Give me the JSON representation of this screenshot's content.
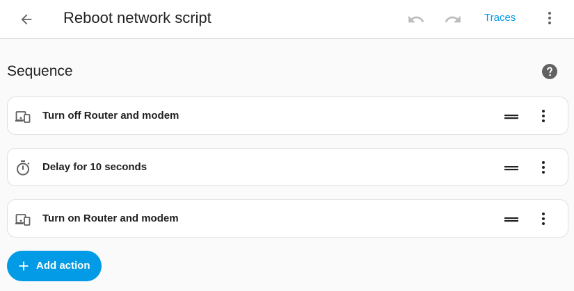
{
  "header": {
    "title": "Reboot network script",
    "traces_label": "Traces",
    "icons": [
      "back-arrow-icon",
      "undo-icon",
      "redo-icon",
      "more-vert-icon"
    ]
  },
  "sequence": {
    "title": "Sequence",
    "help_icon": "help-circle-icon",
    "actions": [
      {
        "label": "Turn off Router and modem",
        "icon": "devices-icon"
      },
      {
        "label": "Delay for 10 seconds",
        "icon": "timer-icon"
      },
      {
        "label": "Turn on Router and modem",
        "icon": "devices-icon"
      }
    ],
    "add_label": "Add action"
  },
  "colors": {
    "accent": "#039be5",
    "text": "#212121",
    "icon": "#616161",
    "disabled": "#bdbdbd",
    "background": "#fafafa"
  }
}
